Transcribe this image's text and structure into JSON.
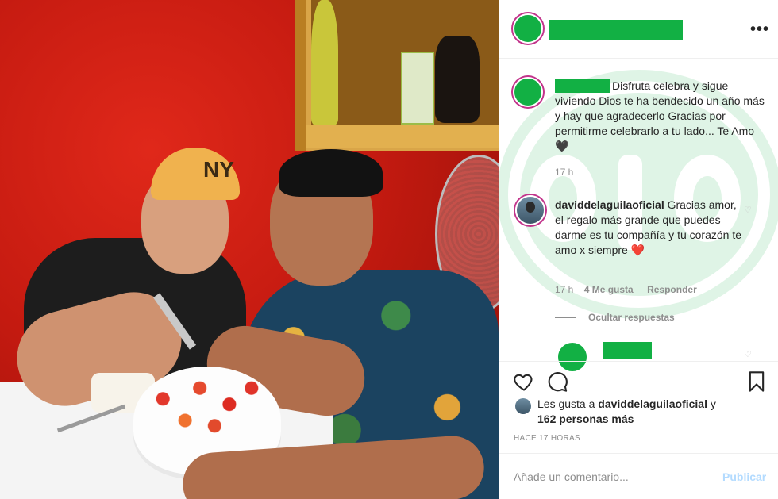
{
  "post": {
    "username_redacted": true,
    "more_icon": "more-horizontal-icon",
    "caption": {
      "text": "Disfruta celebra y sigue viviendo Dios te ha bendecido un año más y hay que agradecerlo Gracias por permitirme celebrarlo a tu lado... Te Amo 🖤",
      "time": "17 h"
    },
    "reply": {
      "username": "daviddelaguilaoficial",
      "text": "Gracias amor, el regalo más grande que puedes darme es tu compañía y tu corazón te amo x siempre ❤️",
      "heart_line": "❤️",
      "time": "17 h",
      "likes": "4 Me gusta",
      "reply_label": "Responder"
    },
    "hide_replies_label": "Ocultar respuestas",
    "likes": {
      "prefix": "Les gusta a ",
      "user": "daviddelaguilaoficial",
      "middle": " y",
      "others": "162 personas más"
    },
    "posted_ago": "HACE 17 HORAS",
    "comment": {
      "placeholder": "Añade un comentario...",
      "publish_label": "Publicar"
    },
    "watermark_text": "ojo"
  },
  "colors": {
    "redaction": "#12b044",
    "text": "#262626",
    "muted": "#8e8e8e",
    "publish_disabled": "#b3dbff",
    "heart_red": "#ed4956"
  }
}
